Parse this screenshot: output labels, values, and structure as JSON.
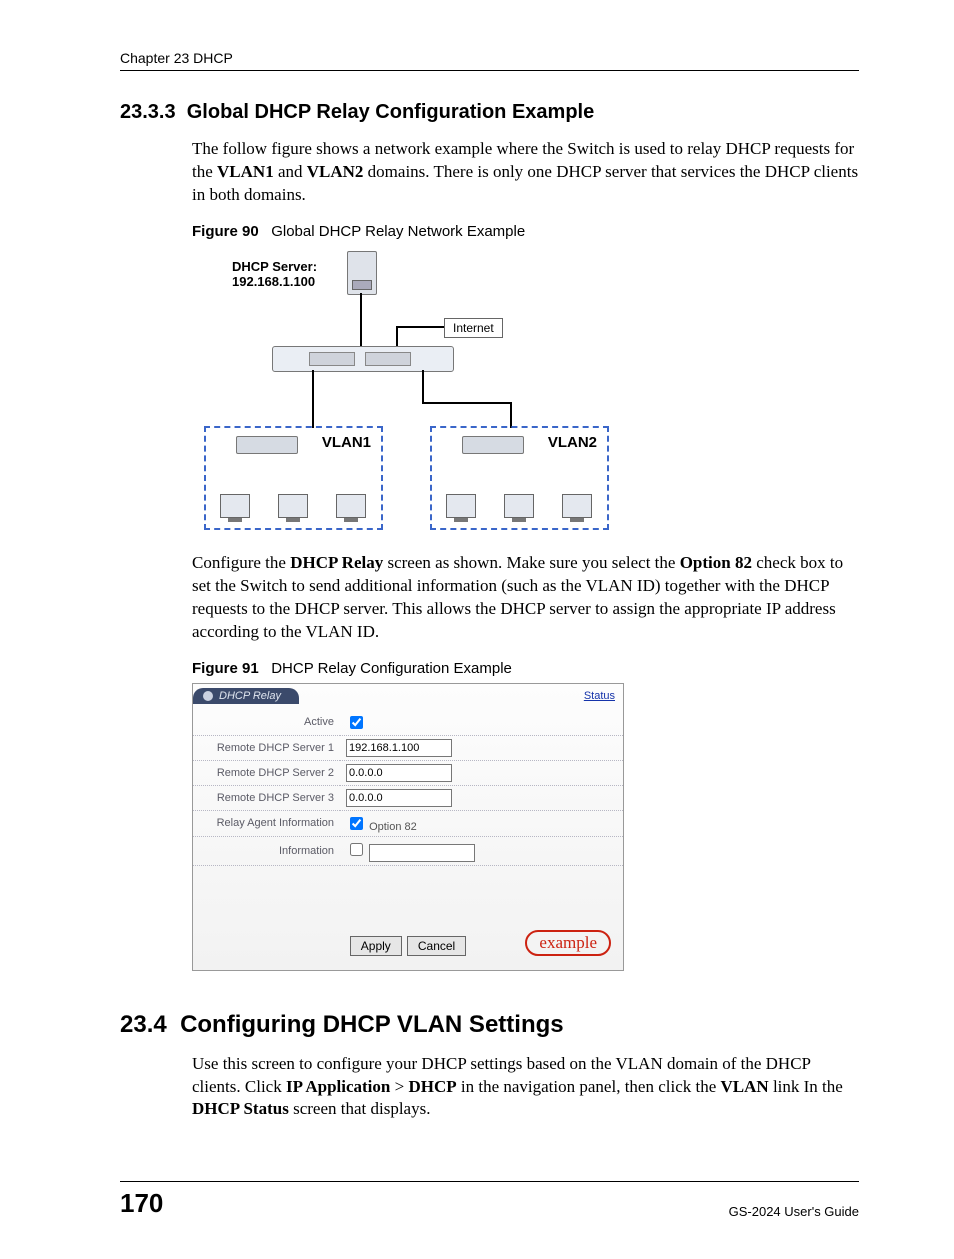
{
  "header": {
    "chapter": "Chapter 23 DHCP"
  },
  "section_2333": {
    "number": "23.3.3",
    "title": "Global DHCP Relay Configuration Example",
    "para1_a": "The follow figure shows a network example where the Switch is used to relay DHCP requests for the ",
    "para1_b": "VLAN1",
    "para1_c": " and ",
    "para1_d": "VLAN2",
    "para1_e": " domains. There is only one DHCP server that services the DHCP clients in both domains."
  },
  "fig90": {
    "label": "Figure 90",
    "caption": "Global DHCP Relay Network Example",
    "server_label_l1": "DHCP Server:",
    "server_label_l2": "192.168.1.100",
    "internet": "Internet",
    "vlan1": "VLAN1",
    "vlan2": "VLAN2"
  },
  "mid_para": {
    "a": "Configure the ",
    "b": "DHCP Relay",
    "c": " screen as shown. Make sure you select the ",
    "d": "Option 82",
    "e": " check box to set the Switch to send additional information (such as the VLAN ID) together with the DHCP requests to the DHCP server. This allows the DHCP server to assign the appropriate IP address according to the VLAN ID."
  },
  "fig91": {
    "label": "Figure 91",
    "caption": "DHCP Relay Configuration Example",
    "tab_title": "DHCP Relay",
    "status_link": "Status",
    "rows": {
      "active": "Active",
      "server1": "Remote DHCP Server 1",
      "server1_val": "192.168.1.100",
      "server2": "Remote DHCP Server 2",
      "server2_val": "0.0.0.0",
      "server3": "Remote DHCP Server 3",
      "server3_val": "0.0.0.0",
      "relay_agent": "Relay Agent Information",
      "option82": "Option 82",
      "information": "Information"
    },
    "buttons": {
      "apply": "Apply",
      "cancel": "Cancel"
    },
    "example_badge": "example"
  },
  "section_234": {
    "number": "23.4",
    "title": "Configuring DHCP VLAN Settings",
    "para_a": "Use this screen to configure your DHCP settings based on the VLAN domain of the DHCP clients. Click ",
    "para_b": "IP Application",
    "para_c": " > ",
    "para_d": "DHCP",
    "para_e": " in the navigation panel, then click the ",
    "para_f": "VLAN",
    "para_g": " link In the ",
    "para_h": "DHCP Status",
    "para_i": " screen that displays."
  },
  "footer": {
    "page": "170",
    "guide": "GS-2024 User's Guide"
  }
}
